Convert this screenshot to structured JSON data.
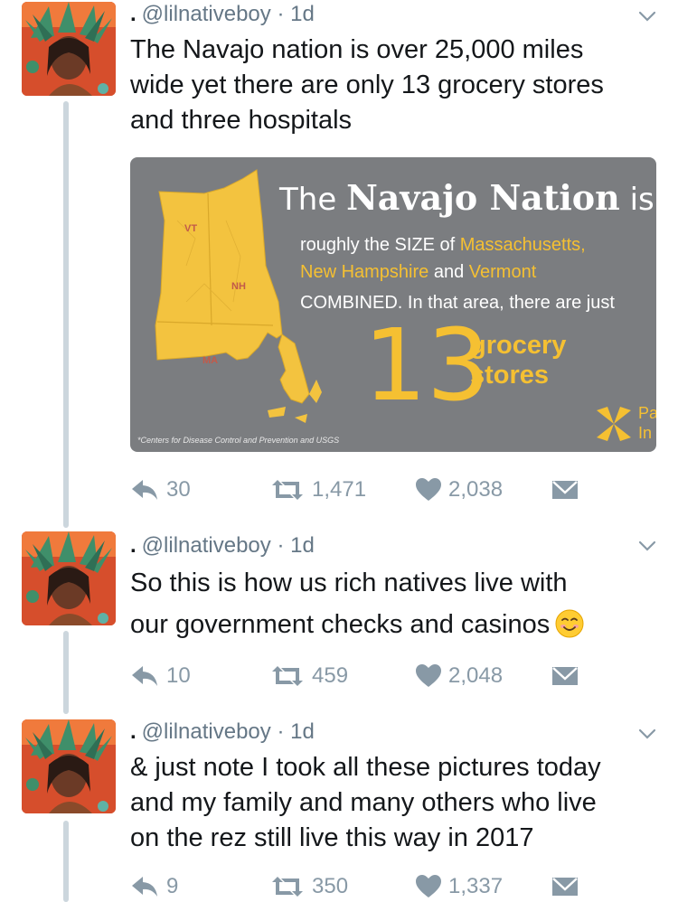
{
  "colors": {
    "text": "#14171a",
    "muted": "#657786",
    "action": "#8899a6",
    "thread": "#ccd6dd",
    "card_bg": "#7b7d80",
    "accent": "#f5c032"
  },
  "tweets": [
    {
      "handle": "@lilnativeboy",
      "time": "1d",
      "lines": [
        "The Navajo nation is over 25,000 miles",
        "wide yet there are only 13 grocery stores",
        "and three hospitals"
      ],
      "replies": "30",
      "retweets": "1,471",
      "likes": "2,038"
    },
    {
      "handle": "@lilnativeboy",
      "time": "1d",
      "lines": [
        "So this is how us rich natives live with",
        "our government checks and casinos"
      ],
      "replies": "10",
      "retweets": "459",
      "likes": "2,048"
    },
    {
      "handle": "@lilnativeboy",
      "time": "1d",
      "lines": [
        "& just note I took all these pictures today",
        "and my family and many others who live",
        "on the rez still live this way in 2017"
      ],
      "replies": "9",
      "retweets": "350",
      "likes": "1,337"
    }
  ],
  "infographic": {
    "title_pre": "The",
    "title_main": "Navajo Nation",
    "title_post": "is",
    "line1": "roughly the SIZE of",
    "line1_hl": "Massachusetts,",
    "line2_hl1": "New Hampshire",
    "line2_and": "and",
    "line2_hl2": "Vermont",
    "line3": "COMBINED. In that area, there are just",
    "number": "13",
    "grocery1": "grocery",
    "grocery2": "stores",
    "source": "*Centers for Disease Control and Prevention and USGS",
    "map_labels": {
      "vt": "VT",
      "nh": "NH",
      "ma": "MA"
    },
    "corner1": "Pa",
    "corner2": "In"
  }
}
